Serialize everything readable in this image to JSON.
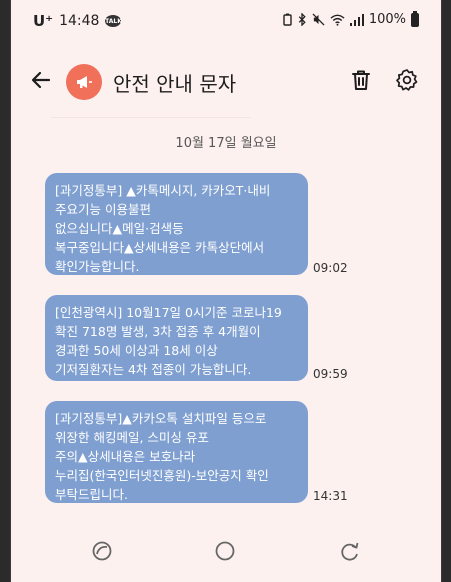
{
  "status_bar": {
    "carrier": "U⁺",
    "time": "14:48",
    "talk_badge": "TALK",
    "battery": "100%"
  },
  "header": {
    "title": "안전 안내 문자"
  },
  "date_label": "10월 17일 월요일",
  "messages": [
    {
      "lines": [
        "[과기정통부] ▲카톡메시지, 카카오T·내비",
        "주요기능 이용불편",
        "없으십니다▲메일·검색등",
        "복구중입니다▲상세내용은 카톡상단에서",
        "확인가능합니다."
      ],
      "time": "09:02"
    },
    {
      "lines": [
        "[인천광역시] 10월17일 0시기준 코로나19",
        "확진 718명 발생, 3차 접종 후 4개월이",
        "경과한 50세 이상과 18세 이상",
        "기저질환자는 4차 접종이 가능합니다."
      ],
      "time": "09:59"
    },
    {
      "lines": [
        "[과기정통부]▲카카오톡 설치파일 등으로",
        "위장한 해킹메일, 스미싱 유포",
        "주의▲상세내용은 보호나라",
        "누리집(한국인터넷진흥원)-보안공지 확인",
        "부탁드립니다."
      ],
      "time": "14:31"
    }
  ],
  "colors": {
    "background": "#fdf1f0",
    "bubble": "#7f9fd0",
    "avatar": "#f0705a"
  }
}
